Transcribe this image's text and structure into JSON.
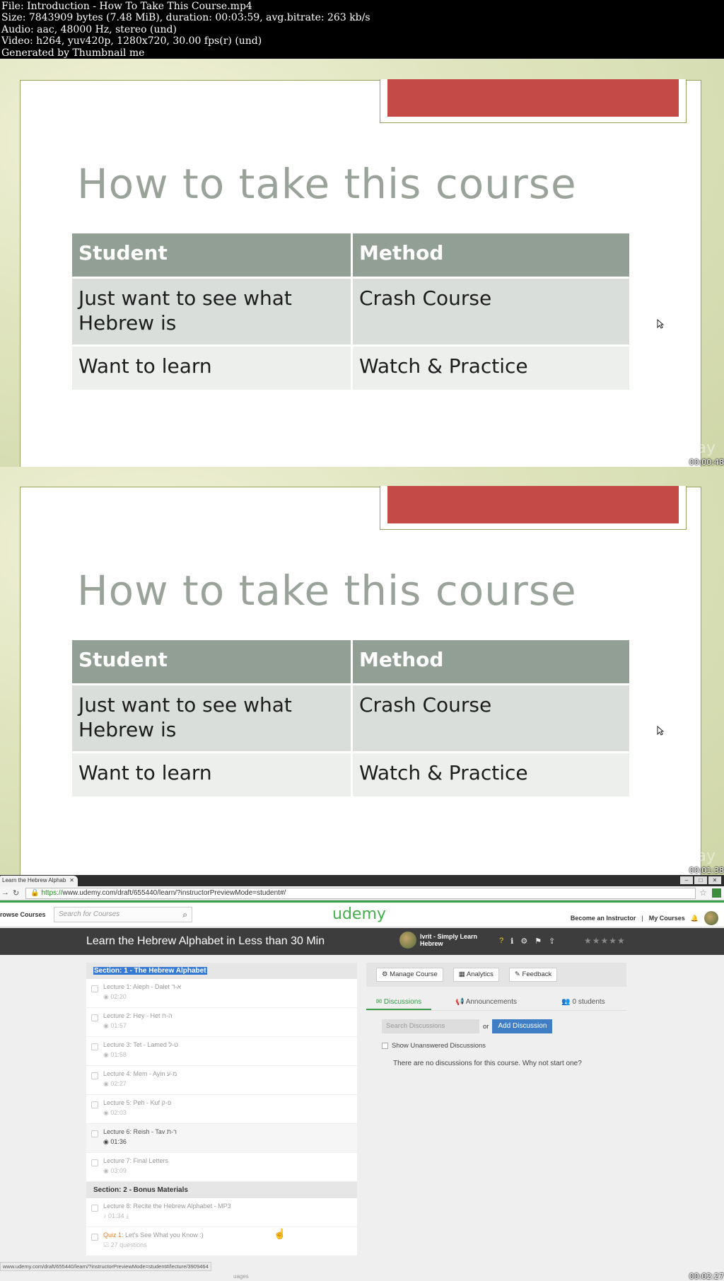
{
  "meta": {
    "line1": "File: Introduction - How To Take This Course.mp4",
    "line2": "Size: 7843909 bytes (7.48 MiB), duration: 00:03:59, avg.bitrate: 263 kb/s",
    "line3": "Audio: aac, 48000 Hz, stereo (und)",
    "line4": "Video: h264, yuv420p, 1280x720, 30.00 fps(r) (und)",
    "line5": "Generated by Thumbnail me"
  },
  "slide": {
    "title": "How to take this course",
    "headers": [
      "Student",
      "Method"
    ],
    "rows": [
      [
        "Just want to see what Hebrew is",
        "Crash Course"
      ],
      [
        "Want to learn",
        "Watch & Practice"
      ]
    ]
  },
  "timestamps": [
    "00:00:48",
    "00:01:38",
    "00:02:27"
  ],
  "browser": {
    "tab_title": "Learn the Hebrew Alphab",
    "url_https": "https://",
    "url_rest": "www.udemy.com/draft/655440/learn/?instructorPreviewMode=student#/",
    "status_url": "www.udemy.com/draft/655440/learn/?instructorPreviewMode=student#/lecture/3909464"
  },
  "site": {
    "browse": "rowse Courses",
    "search_placeholder": "Search for Courses",
    "logo": "udemy",
    "become_instructor": "Become an Instructor",
    "my_courses": "My Courses"
  },
  "course": {
    "title": "Learn the Hebrew Alphabet in Less than 30 Min",
    "instructor": "Ivrit - Simply Learn Hebrew",
    "rating": "★★★★★"
  },
  "curriculum": {
    "section1": "Section: 1 - The Hebrew Alphabet",
    "section2": "Section: 2 - Bonus Materials",
    "lectures": [
      {
        "name": "Lecture 1: Aleph - Dalet א-ד",
        "dur": "02:20"
      },
      {
        "name": "Lecture 2: Hey - Het ה-ח",
        "dur": "01:57"
      },
      {
        "name": "Lecture 3: Tet - Lamed ט-ל",
        "dur": "01:58"
      },
      {
        "name": "Lecture 4: Mem - Ayin מ-ע",
        "dur": "02:27"
      },
      {
        "name": "Lecture 5: Peh - Kuf פ-ק",
        "dur": "02:03"
      },
      {
        "name": "Lecture 6: Reish - Tav ר-ת",
        "dur": "01:36"
      },
      {
        "name": "Lecture 7: Final Letters",
        "dur": "03:09"
      },
      {
        "name": "Lecture 8: Recite the Hebrew Alphabet - MP3",
        "dur": "01:34"
      }
    ],
    "quiz_label": "Quiz 1:",
    "quiz_name": "Let's See What you Know :)",
    "quiz_questions": "27 questions",
    "bottom_fragment": "uages"
  },
  "discussion": {
    "manage": "Manage Course",
    "analytics": "Analytics",
    "feedback": "Feedback",
    "tab_discussions": "Discussions",
    "tab_announcements": "Announcements",
    "tab_students": "0 students",
    "search_placeholder": "Search Discussions",
    "or": "or",
    "add": "Add Discussion",
    "unanswered": "Show Unanswered Discussions",
    "empty": "There are no discussions for this course. Why not start one?"
  },
  "colors": {
    "accent_red": "#c44b45",
    "table_header": "#919f94",
    "udemy_green": "#43b04a",
    "course_bar": "#3d3d3d",
    "add_button": "#3f7ec5"
  }
}
